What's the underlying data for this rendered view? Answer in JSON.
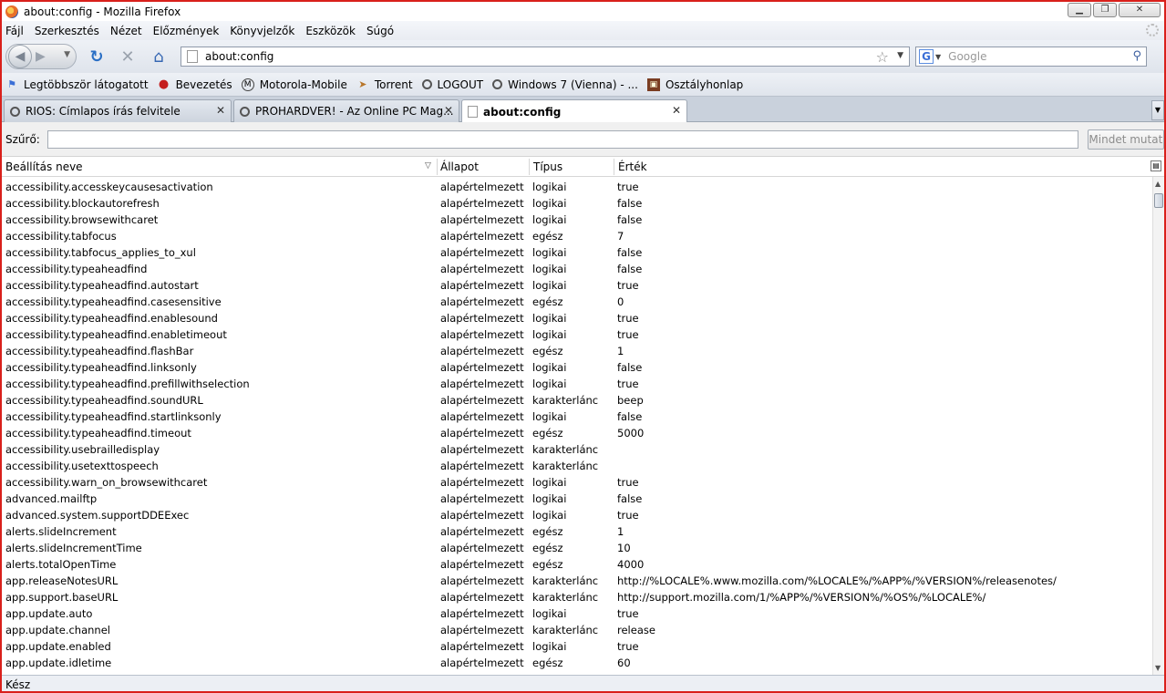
{
  "window": {
    "title": "about:config - Mozilla Firefox"
  },
  "menu": [
    "Fájl",
    "Szerkesztés",
    "Nézet",
    "Előzmények",
    "Könyvjelzők",
    "Eszközök",
    "Súgó"
  ],
  "nav": {
    "url": "about:config",
    "search_placeholder": "Google"
  },
  "bookmarks": [
    {
      "label": "Legtöbbször látogatott",
      "icon": "most-visited-icon"
    },
    {
      "label": "Bevezetés",
      "icon": "firefox-icon"
    },
    {
      "label": "Motorola-Mobile",
      "icon": "motorola-icon"
    },
    {
      "label": "Torrent",
      "icon": "torrent-icon"
    },
    {
      "label": "LOGOUT",
      "icon": "loading-icon"
    },
    {
      "label": "Windows 7 (Vienna) - ...",
      "icon": "loading-icon"
    },
    {
      "label": "Osztályhonlap",
      "icon": "site-icon"
    }
  ],
  "tabs": [
    {
      "label": "RIOS: Címlapos írás felvitele",
      "active": false
    },
    {
      "label": "PROHARDVER! - Az Online PC Mag...",
      "active": false
    },
    {
      "label": "about:config",
      "active": true
    }
  ],
  "filter": {
    "label": "Szűrő:",
    "value": "",
    "show_all": "Mindet mutat"
  },
  "columns": {
    "name": "Beállítás neve",
    "state": "Állapot",
    "type": "Típus",
    "value": "Érték"
  },
  "rows": [
    {
      "name": "accessibility.accesskeycausesactivation",
      "state": "alapértelmezett",
      "type": "logikai",
      "value": "true"
    },
    {
      "name": "accessibility.blockautorefresh",
      "state": "alapértelmezett",
      "type": "logikai",
      "value": "false"
    },
    {
      "name": "accessibility.browsewithcaret",
      "state": "alapértelmezett",
      "type": "logikai",
      "value": "false"
    },
    {
      "name": "accessibility.tabfocus",
      "state": "alapértelmezett",
      "type": "egész",
      "value": "7"
    },
    {
      "name": "accessibility.tabfocus_applies_to_xul",
      "state": "alapértelmezett",
      "type": "logikai",
      "value": "false"
    },
    {
      "name": "accessibility.typeaheadfind",
      "state": "alapértelmezett",
      "type": "logikai",
      "value": "false"
    },
    {
      "name": "accessibility.typeaheadfind.autostart",
      "state": "alapértelmezett",
      "type": "logikai",
      "value": "true"
    },
    {
      "name": "accessibility.typeaheadfind.casesensitive",
      "state": "alapértelmezett",
      "type": "egész",
      "value": "0"
    },
    {
      "name": "accessibility.typeaheadfind.enablesound",
      "state": "alapértelmezett",
      "type": "logikai",
      "value": "true"
    },
    {
      "name": "accessibility.typeaheadfind.enabletimeout",
      "state": "alapértelmezett",
      "type": "logikai",
      "value": "true"
    },
    {
      "name": "accessibility.typeaheadfind.flashBar",
      "state": "alapértelmezett",
      "type": "egész",
      "value": "1"
    },
    {
      "name": "accessibility.typeaheadfind.linksonly",
      "state": "alapértelmezett",
      "type": "logikai",
      "value": "false"
    },
    {
      "name": "accessibility.typeaheadfind.prefillwithselection",
      "state": "alapértelmezett",
      "type": "logikai",
      "value": "true"
    },
    {
      "name": "accessibility.typeaheadfind.soundURL",
      "state": "alapértelmezett",
      "type": "karakterlánc",
      "value": "beep"
    },
    {
      "name": "accessibility.typeaheadfind.startlinksonly",
      "state": "alapértelmezett",
      "type": "logikai",
      "value": "false"
    },
    {
      "name": "accessibility.typeaheadfind.timeout",
      "state": "alapértelmezett",
      "type": "egész",
      "value": "5000"
    },
    {
      "name": "accessibility.usebrailledisplay",
      "state": "alapértelmezett",
      "type": "karakterlánc",
      "value": ""
    },
    {
      "name": "accessibility.usetexttospeech",
      "state": "alapértelmezett",
      "type": "karakterlánc",
      "value": ""
    },
    {
      "name": "accessibility.warn_on_browsewithcaret",
      "state": "alapértelmezett",
      "type": "logikai",
      "value": "true"
    },
    {
      "name": "advanced.mailftp",
      "state": "alapértelmezett",
      "type": "logikai",
      "value": "false"
    },
    {
      "name": "advanced.system.supportDDEExec",
      "state": "alapértelmezett",
      "type": "logikai",
      "value": "true"
    },
    {
      "name": "alerts.slideIncrement",
      "state": "alapértelmezett",
      "type": "egész",
      "value": "1"
    },
    {
      "name": "alerts.slideIncrementTime",
      "state": "alapértelmezett",
      "type": "egész",
      "value": "10"
    },
    {
      "name": "alerts.totalOpenTime",
      "state": "alapértelmezett",
      "type": "egész",
      "value": "4000"
    },
    {
      "name": "app.releaseNotesURL",
      "state": "alapértelmezett",
      "type": "karakterlánc",
      "value": "http://%LOCALE%.www.mozilla.com/%LOCALE%/%APP%/%VERSION%/releasenotes/"
    },
    {
      "name": "app.support.baseURL",
      "state": "alapértelmezett",
      "type": "karakterlánc",
      "value": "http://support.mozilla.com/1/%APP%/%VERSION%/%OS%/%LOCALE%/"
    },
    {
      "name": "app.update.auto",
      "state": "alapértelmezett",
      "type": "logikai",
      "value": "true"
    },
    {
      "name": "app.update.channel",
      "state": "alapértelmezett",
      "type": "karakterlánc",
      "value": "release"
    },
    {
      "name": "app.update.enabled",
      "state": "alapértelmezett",
      "type": "logikai",
      "value": "true"
    },
    {
      "name": "app.update.idletime",
      "state": "alapértelmezett",
      "type": "egész",
      "value": "60"
    }
  ],
  "status": {
    "text": "Kész"
  },
  "colors": {
    "frame_border": "#d9201b",
    "accent_blue": "#2a6fc5"
  }
}
